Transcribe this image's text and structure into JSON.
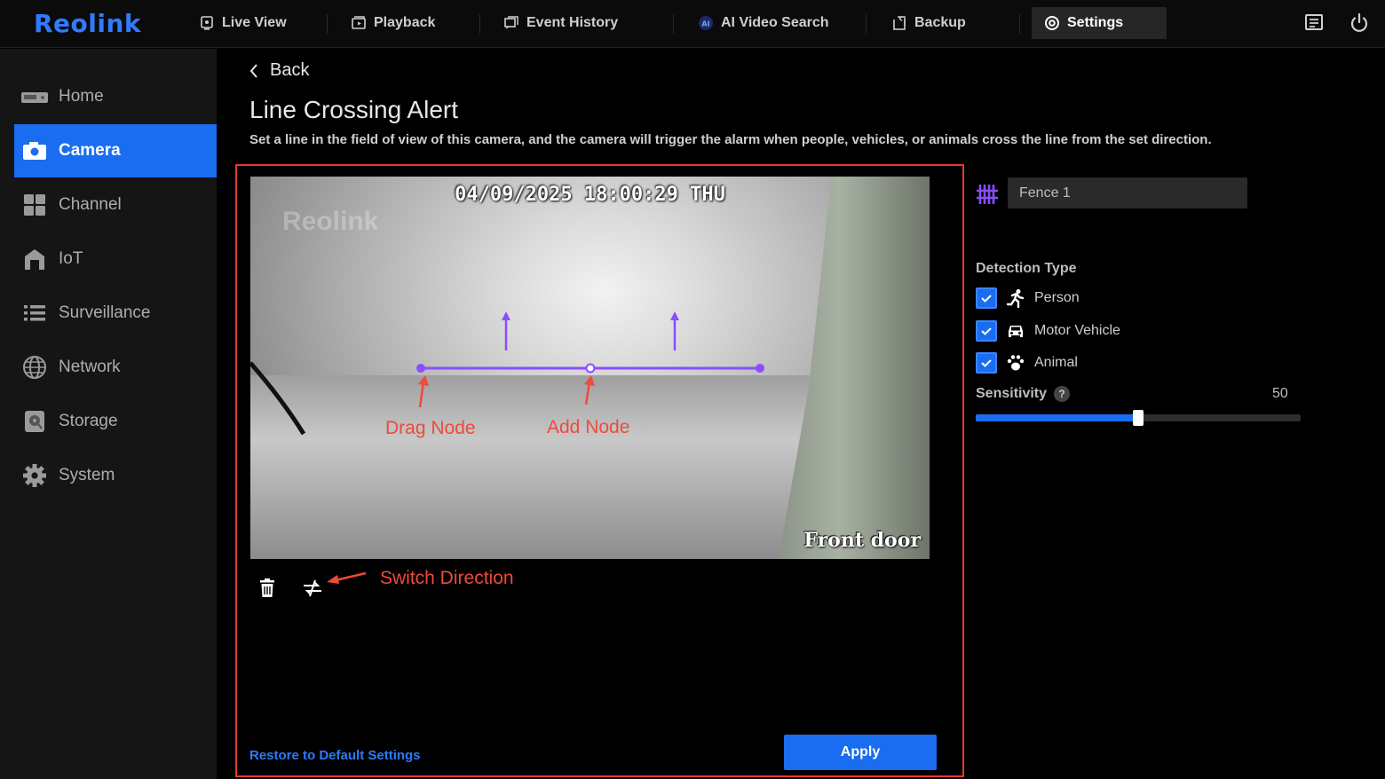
{
  "brand": {
    "logo": "Reolink"
  },
  "topnav": {
    "items": [
      {
        "label": "Live View",
        "icon": "live-view-icon"
      },
      {
        "label": "Playback",
        "icon": "playback-icon"
      },
      {
        "label": "Event History",
        "icon": "event-history-icon"
      },
      {
        "label": "AI Video Search",
        "icon": "ai-search-icon"
      },
      {
        "label": "Backup",
        "icon": "backup-icon"
      },
      {
        "label": "Settings",
        "icon": "settings-icon",
        "active": true
      }
    ]
  },
  "sidebar": {
    "items": [
      {
        "label": "Home",
        "icon": "home-icon"
      },
      {
        "label": "Camera",
        "icon": "camera-icon",
        "active": true
      },
      {
        "label": "Channel",
        "icon": "channel-icon"
      },
      {
        "label": "IoT",
        "icon": "iot-icon"
      },
      {
        "label": "Surveillance",
        "icon": "surveillance-icon"
      },
      {
        "label": "Network",
        "icon": "network-icon"
      },
      {
        "label": "Storage",
        "icon": "storage-icon"
      },
      {
        "label": "System",
        "icon": "system-icon"
      }
    ]
  },
  "main": {
    "back_label": "Back",
    "title": "Line Crossing Alert",
    "description": "Set a line in the field of view of this camera, and the camera will trigger the alarm when people, vehicles, or animals cross the line from the set direction.",
    "video": {
      "timestamp": "04/09/2025 18:00:29 THU",
      "camera_name": "Front door",
      "watermark": "Reolink"
    },
    "annotations": {
      "drag_node": "Drag Node",
      "add_node": "Add Node",
      "switch_direction": "Switch Direction"
    },
    "restore_label": "Restore to Default Settings",
    "apply_label": "Apply"
  },
  "panel": {
    "fence_name": "Fence 1",
    "detection_type_label": "Detection Type",
    "detection_types": [
      {
        "label": "Person",
        "checked": true,
        "icon": "person-running-icon"
      },
      {
        "label": "Motor Vehicle",
        "checked": true,
        "icon": "car-icon"
      },
      {
        "label": "Animal",
        "checked": true,
        "icon": "paw-icon"
      }
    ],
    "sensitivity_label": "Sensitivity",
    "sensitivity_help": "?",
    "sensitivity_value": "50",
    "sensitivity_fraction": 0.5
  },
  "colors": {
    "accent": "#1a6df0",
    "line": "#8a4dff",
    "annotation": "#ef4a3c",
    "highlight_frame": "#e5392c"
  }
}
